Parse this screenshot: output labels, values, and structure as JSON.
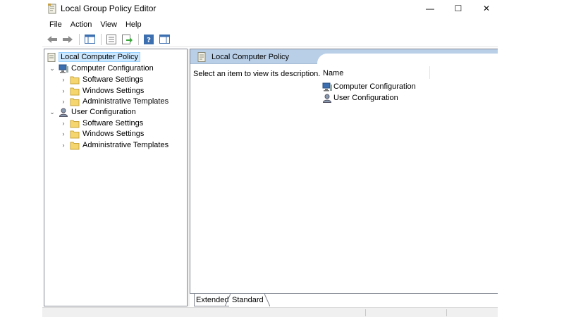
{
  "window": {
    "title": "Local Group Policy Editor",
    "minimize_glyph": "—",
    "maximize_glyph": "☐",
    "close_glyph": "✕"
  },
  "menu": [
    "File",
    "Action",
    "View",
    "Help"
  ],
  "toolbar": {
    "icons": [
      "back-arrow-icon",
      "forward-arrow-icon",
      "show-hide-console-tree-icon",
      "properties-icon",
      "export-list-icon",
      "help-icon",
      "show-hide-action-pane-icon"
    ]
  },
  "tree": {
    "root": "Local Computer Policy",
    "computer_config": "Computer Configuration",
    "computer_children": [
      "Software Settings",
      "Windows Settings",
      "Administrative Templates"
    ],
    "user_config": "User Configuration",
    "user_children": [
      "Software Settings",
      "Windows Settings",
      "Administrative Templates"
    ]
  },
  "right_pane": {
    "header_title": "Local Computer Policy",
    "description": "Select an item to view its description.",
    "column_name": "Name",
    "items": [
      "Computer Configuration",
      "User Configuration"
    ]
  },
  "tabs": [
    "Extended",
    "Standard"
  ],
  "colors": {
    "header_blue": "#b9cfe8",
    "selection": "#cce8ff",
    "folder_yellow": "#f5d66e"
  }
}
